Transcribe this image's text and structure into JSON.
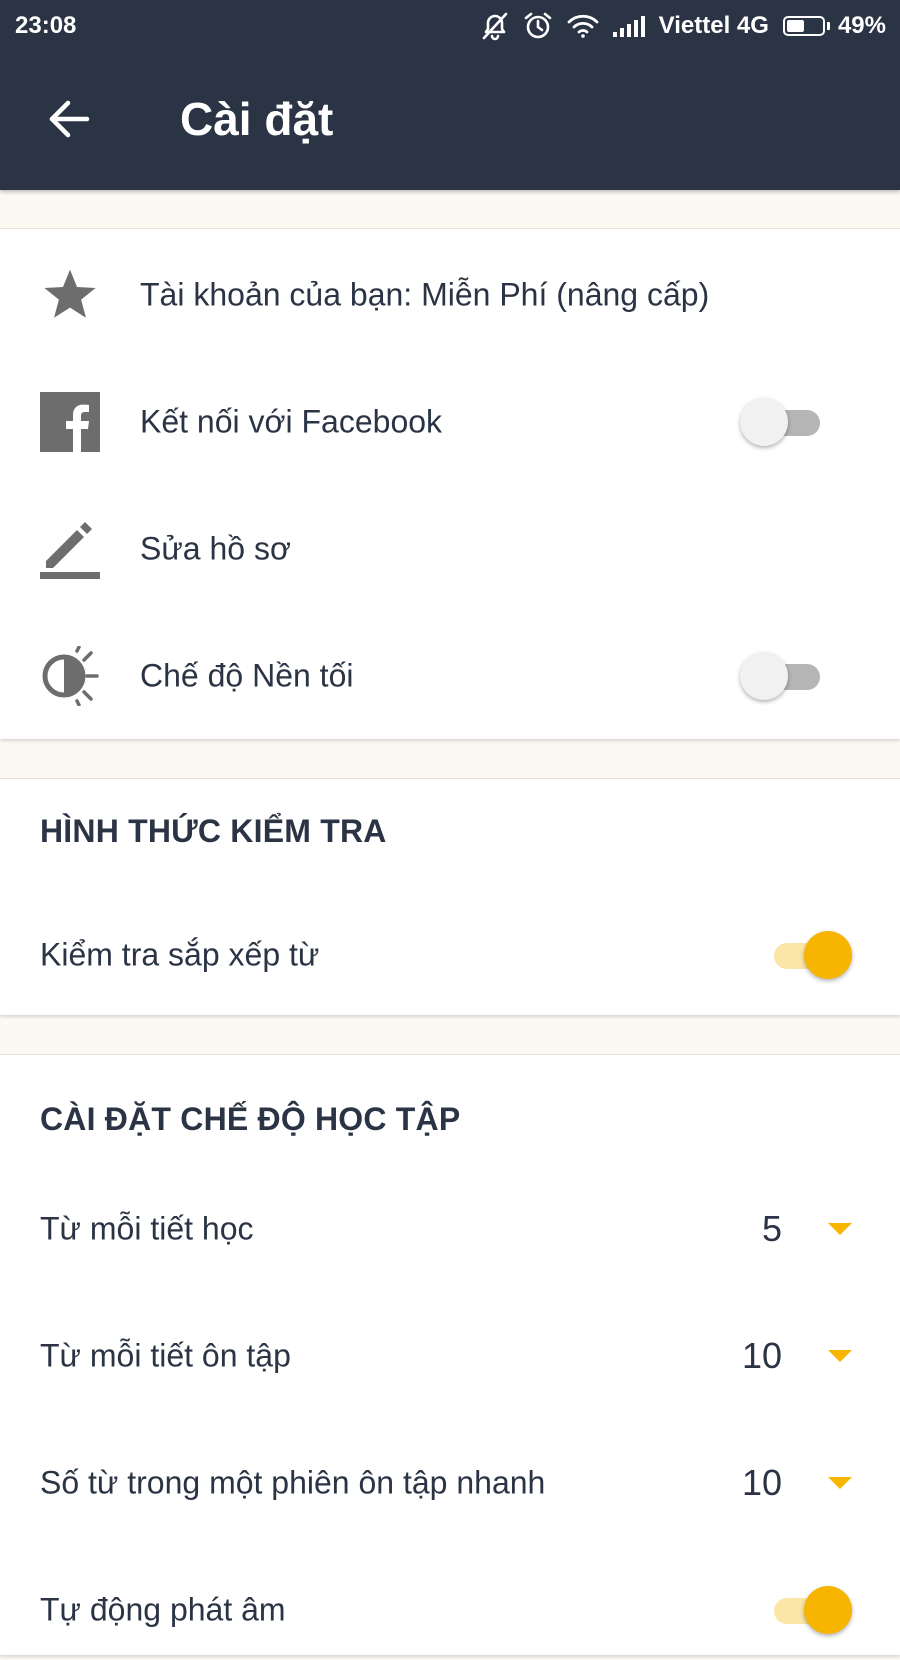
{
  "status_bar": {
    "time": "23:08",
    "carrier": "Viettel 4G",
    "battery": "49%",
    "battery_level": 0.49,
    "icons": [
      "notifications-off-icon",
      "alarm-icon",
      "wifi-icon",
      "signal-icon",
      "battery-icon"
    ]
  },
  "header": {
    "title": "Cài đặt",
    "back_icon": "arrow-back-icon",
    "background": "#2b3445"
  },
  "account": {
    "items": [
      {
        "icon": "star-icon",
        "label": "Tài khoản của bạn: Miễn Phí (nâng cấp)"
      },
      {
        "icon": "facebook-icon",
        "label": "Kết nối với Facebook",
        "toggle": false
      },
      {
        "icon": "edit-pencil-icon",
        "label": "Sửa hồ sơ"
      },
      {
        "icon": "dark-mode-icon",
        "label": "Chế độ Nền tối",
        "toggle": false
      }
    ]
  },
  "test_section": {
    "title": "HÌNH THỨC KIỂM TRA",
    "items": [
      {
        "label": "Kiểm tra sắp xếp từ",
        "toggle": true
      }
    ]
  },
  "learning_section": {
    "title": "CÀI ĐẶT CHẾ ĐỘ HỌC TẬP",
    "items": [
      {
        "label": "Từ mỗi tiết học",
        "value": "5"
      },
      {
        "label": "Từ mỗi tiết ôn tập",
        "value": "10"
      },
      {
        "label": "Số từ trong một phiên ôn tập nhanh",
        "value": "10"
      },
      {
        "label": "Tự động phát âm",
        "toggle": true
      }
    ]
  },
  "colors": {
    "accent": "#f7b400",
    "accent_light": "#fbe6a8",
    "text": "#2b3445",
    "icon_gray": "#6d6d6d",
    "page_bg": "#fcf9f2"
  }
}
